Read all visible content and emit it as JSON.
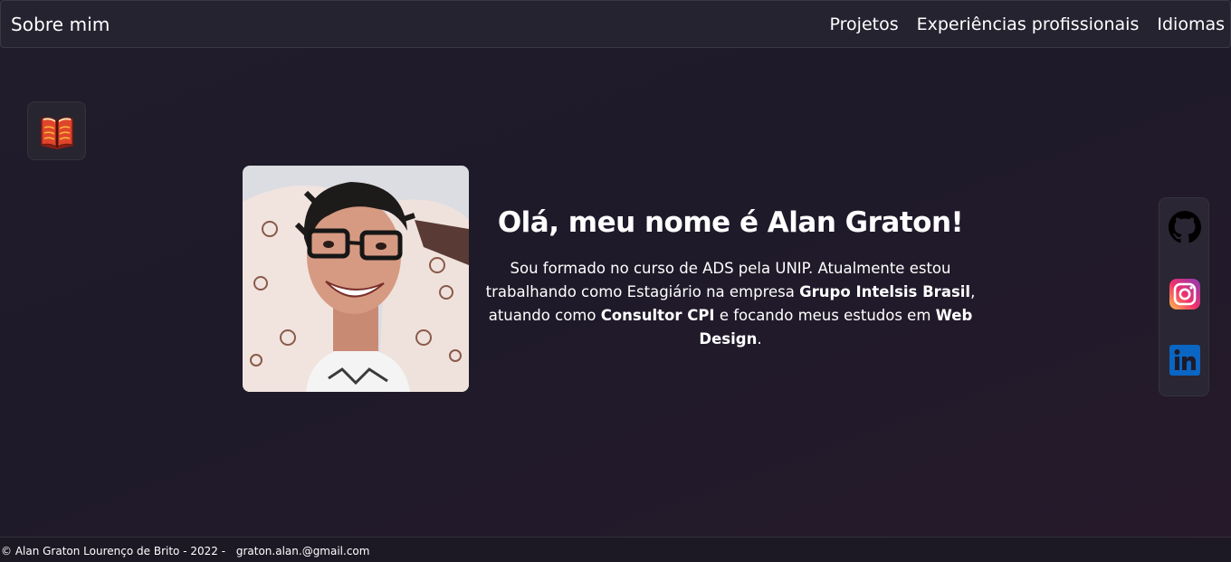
{
  "navbar": {
    "brand": "Sobre mim",
    "links": [
      "Projetos",
      "Experiências profissionais",
      "Idiomas"
    ]
  },
  "sidebar_left": {
    "icon": "open-book-icon"
  },
  "profile": {
    "photo_alt": "Alan Graton",
    "title": "Olá, meu nome é Alan Graton!",
    "bio": {
      "t1": "Sou formado no curso de ADS pela UNIP. Atualmente estou trabalhando como Estagiário na empresa ",
      "company": "Grupo Intelsis Brasil",
      "t2": ", atuando como ",
      "role": "Consultor CPI",
      "t3": " e focando meus estudos em ",
      "focus": "Web Design",
      "t4": "."
    }
  },
  "social": {
    "items": [
      {
        "icon": "github-icon",
        "label": "GitHub"
      },
      {
        "icon": "instagram-icon",
        "label": "Instagram"
      },
      {
        "icon": "linkedin-icon",
        "label": "in"
      }
    ]
  },
  "footer": {
    "copyright": "© Alan Graton Lourenço de Brito - 2022 -",
    "email": "graton.alan.@gmail.com"
  },
  "colors": {
    "background": "#201c2c",
    "navbar": "#252330",
    "linkedin": "#0a66c2",
    "book": "#e0452b"
  }
}
